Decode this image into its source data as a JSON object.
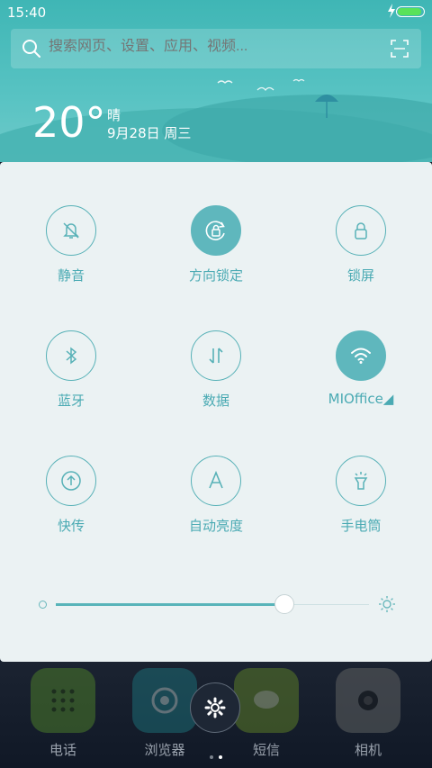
{
  "status": {
    "time": "15:40",
    "battery_level": 1.0
  },
  "search": {
    "placeholder": "搜索网页、设置、应用、视频..."
  },
  "weather": {
    "temperature": "20°",
    "condition": "晴",
    "date": "9月28日 周三"
  },
  "toggles": [
    {
      "label": "静音",
      "icon": "mute-bell-icon",
      "active": false
    },
    {
      "label": "方向锁定",
      "icon": "rotation-lock-icon",
      "active": true
    },
    {
      "label": "锁屏",
      "icon": "padlock-icon",
      "active": false
    },
    {
      "label": "蓝牙",
      "icon": "bluetooth-icon",
      "active": false
    },
    {
      "label": "数据",
      "icon": "mobile-data-icon",
      "active": false
    },
    {
      "label": "MIOffice◢",
      "icon": "wifi-icon",
      "active": true
    },
    {
      "label": "快传",
      "icon": "share-upload-icon",
      "active": false
    },
    {
      "label": "自动亮度",
      "icon": "auto-brightness-icon",
      "active": false
    },
    {
      "label": "手电筒",
      "icon": "flashlight-icon",
      "active": false
    }
  ],
  "brightness": {
    "level": 0.73
  },
  "dock": {
    "apps": [
      {
        "label": "电话",
        "icon": "phone-icon",
        "color": "#4a7a2a"
      },
      {
        "label": "浏览器",
        "icon": "browser-icon",
        "color": "#1c6b74"
      },
      {
        "label": "短信",
        "icon": "message-icon",
        "color": "#5a7a28"
      },
      {
        "label": "相机",
        "icon": "camera-icon",
        "color": "#5e6161"
      }
    ],
    "page_count": 2,
    "current_page": 2
  },
  "colors": {
    "accent": "#5fb7bd",
    "panel": "#ebf2f3",
    "sky": "#4fbebd"
  }
}
